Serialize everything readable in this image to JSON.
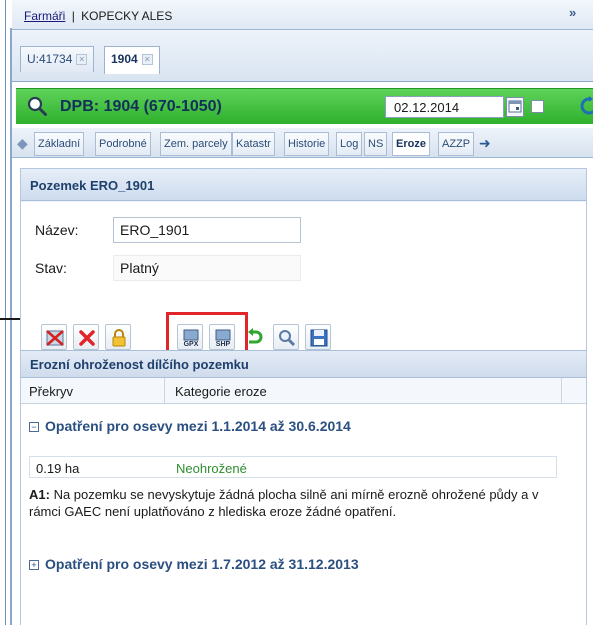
{
  "header": {
    "breadcrumb_link": "Farmáři",
    "breadcrumb_sep": "|",
    "breadcrumb_name": "KOPECKY ALES",
    "collapse_icon": "»"
  },
  "doc_tabs": [
    {
      "label": "U:41734",
      "active": false
    },
    {
      "label": "1904",
      "active": true
    }
  ],
  "dpb_bar": {
    "title": "DPB: 1904 (670-1050)",
    "date": "02.12.2014",
    "accent_color": "#3cbf38"
  },
  "sub_tabs": [
    {
      "label": "Základní",
      "active": false
    },
    {
      "label": "Podrobné",
      "active": false
    },
    {
      "label": "Zem. parcely",
      "active": false
    },
    {
      "label": "Katastr",
      "active": false
    },
    {
      "label": "Historie",
      "active": false
    },
    {
      "label": "Log",
      "active": false
    },
    {
      "label": "NS",
      "active": false
    },
    {
      "label": "Eroze",
      "active": true
    },
    {
      "label": "AZZP",
      "active": false
    }
  ],
  "parcel": {
    "heading": "Pozemek ERO_1901",
    "name_label": "Název:",
    "name_value": "ERO_1901",
    "state_label": "Stav:",
    "state_value": "Platný"
  },
  "toolbar": {
    "icons": [
      "delete-map-icon",
      "delete-icon",
      "lock-icon",
      "gpx-export-icon",
      "shp-export-icon",
      "undo-icon",
      "zoom-icon",
      "save-icon"
    ],
    "gpx_text": "GPX",
    "shp_text": "SHP"
  },
  "erosion": {
    "heading": "Erozní ohroženost dílčího pozemku",
    "col_overlap": "Překryv",
    "col_category": "Kategorie eroze",
    "group1": {
      "toggle": "−",
      "title": "Opatření pro osevy mezi 1.1.2014 až 30.6.2014",
      "area": "0.19 ha",
      "category": "Neohrožené",
      "note_code": "A1:",
      "note_text": "Na pozemku se nevyskytuje žádná plocha silně ani mírně erozně ohrožené půdy a v rámci GAEC není uplatňováno z hlediska eroze žádné opatření."
    },
    "group2": {
      "toggle": "+",
      "title": "Opatření pro osevy mezi 1.7.2012 až 31.12.2013"
    }
  }
}
